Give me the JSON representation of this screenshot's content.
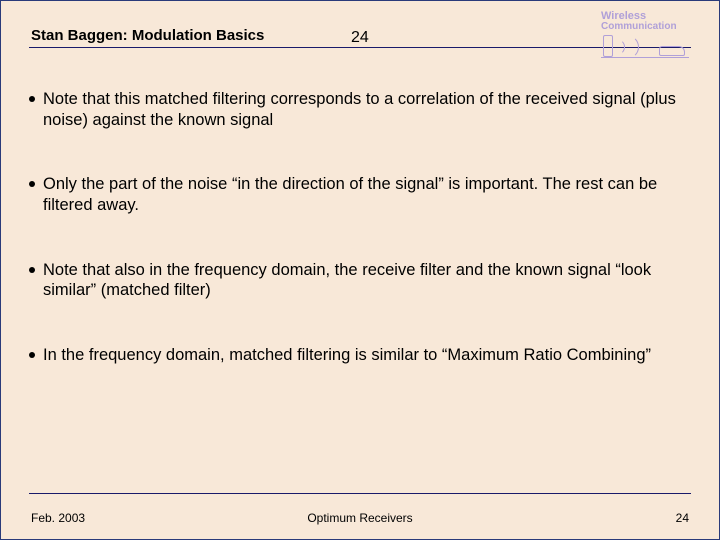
{
  "header": {
    "title": "Stan Baggen: Modulation Basics",
    "page_number": "24",
    "logo": {
      "line1": "Wireless",
      "line2": "Communication"
    }
  },
  "bullets": [
    "Note that this matched filtering corresponds to a correlation of the received signal (plus noise) against the known signal",
    "Only the part of the noise “in the direction of the signal” is important. The rest can be filtered away.",
    "Note that also in the frequency domain, the receive filter and the known signal “look similar” (matched filter)",
    "In the frequency domain, matched filtering is similar to “Maximum Ratio Combining”"
  ],
  "footer": {
    "left": "Feb. 2003",
    "center": "Optimum Receivers",
    "right": "24"
  }
}
